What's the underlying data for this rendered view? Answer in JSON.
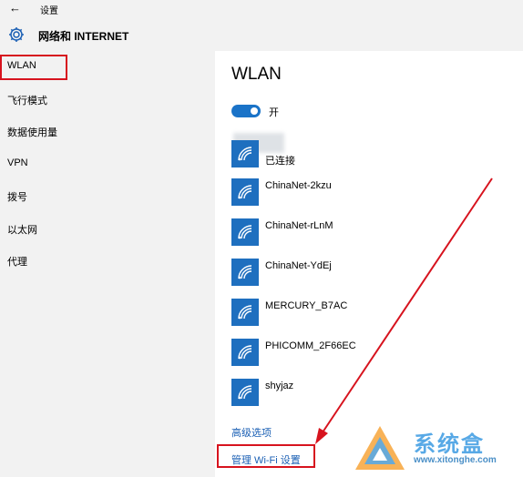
{
  "window": {
    "back_glyph": "←",
    "title": "设置"
  },
  "header": {
    "title": "网络和 INTERNET",
    "icon": "gear-icon"
  },
  "sidebar": {
    "items": [
      {
        "label": "WLAN",
        "selected": true
      },
      {
        "label": "飞行模式"
      },
      {
        "label": "数据使用量"
      },
      {
        "label": "VPN"
      },
      {
        "label": "拨号"
      },
      {
        "label": "以太网"
      },
      {
        "label": "代理"
      }
    ]
  },
  "content": {
    "title": "WLAN",
    "toggle": {
      "state": "on",
      "label": "开"
    },
    "networks": [
      {
        "name": "",
        "status": "已连接",
        "icon": "wifi-icon"
      },
      {
        "name": "ChinaNet-2kzu",
        "icon": "wifi-icon"
      },
      {
        "name": "ChinaNet-rLnM",
        "icon": "wifi-icon"
      },
      {
        "name": "ChinaNet-YdEj",
        "icon": "wifi-icon"
      },
      {
        "name": "MERCURY_B7AC",
        "icon": "wifi-icon"
      },
      {
        "name": "PHICOMM_2F66EC",
        "icon": "wifi-icon"
      },
      {
        "name": "shyjaz",
        "icon": "wifi-icon"
      }
    ],
    "advanced_link": "高级选项",
    "manage_link": "管理 Wi-Fi 设置"
  },
  "watermark": {
    "brand": "系统盒",
    "url": "www.xitonghe.com"
  },
  "colors": {
    "accent": "#1a73c8",
    "tile": "#1e6fbf",
    "highlight": "#d7131e",
    "link": "#1a5fb4"
  }
}
